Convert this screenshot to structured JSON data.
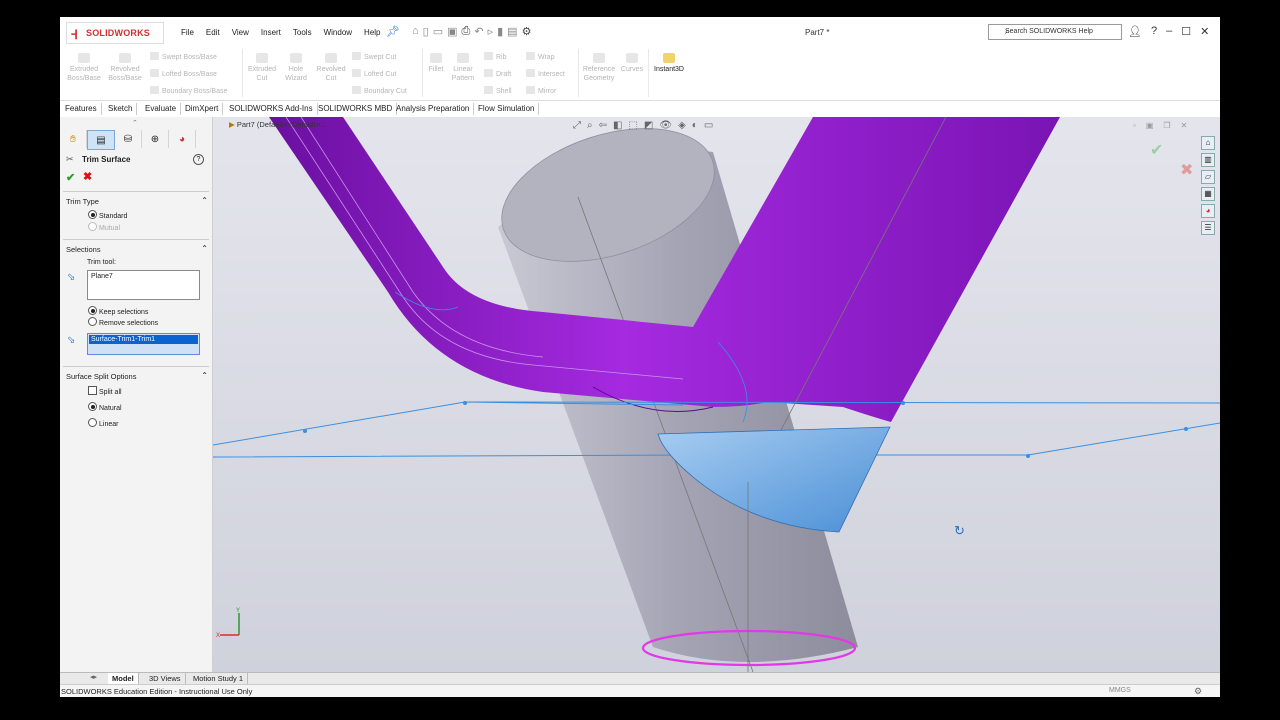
{
  "app": {
    "brand": "SOLIDWORKS",
    "document_title": "Part7 *",
    "help_search_placeholder": "Search SOLIDWORKS Help"
  },
  "menu": [
    "File",
    "Edit",
    "View",
    "Insert",
    "Tools",
    "Window",
    "Help"
  ],
  "ribbon": {
    "extruded_boss": "Extruded Boss/Base",
    "revolved_boss": "Revolved Boss/Base",
    "swept_boss": "Swept Boss/Base",
    "lofted_boss": "Lofted Boss/Base",
    "boundary_boss": "Boundary Boss/Base",
    "extruded_cut": "Extruded Cut",
    "hole_wizard": "Hole Wizard",
    "revolved_cut": "Revolved Cut",
    "swept_cut": "Swept Cut",
    "lofted_cut": "Lofted Cut",
    "boundary_cut": "Boundary Cut",
    "fillet": "Fillet",
    "linear_pattern": "Linear Pattern",
    "rib": "Rib",
    "draft": "Draft",
    "shell": "Shell",
    "wrap": "Wrap",
    "intersect": "Intersect",
    "mirror": "Mirror",
    "reference_geometry": "Reference Geometry",
    "curves": "Curves",
    "instant3d": "Instant3D"
  },
  "command_tabs": [
    "Features",
    "Sketch",
    "Evaluate",
    "DimXpert",
    "SOLIDWORKS Add-Ins",
    "SOLIDWORKS MBD",
    "Analysis Preparation",
    "Flow Simulation"
  ],
  "property_manager": {
    "title": "Trim Surface",
    "help_glyph": "?",
    "ok_glyph": "✔",
    "cancel_glyph": "✖",
    "trim_type": {
      "header": "Trim Type",
      "options": [
        "Standard",
        "Mutual"
      ],
      "selected": "Standard"
    },
    "selections": {
      "header": "Selections",
      "trim_tool_label": "Trim tool:",
      "trim_tool_value": "Plane7",
      "keep_label": "Keep selections",
      "remove_label": "Remove selections",
      "selected_surface": "Surface-Trim1-Trim1"
    },
    "split_options": {
      "header": "Surface Split Options",
      "split_all_label": "Split all",
      "natural_label": "Natural",
      "linear_label": "Linear"
    }
  },
  "viewport": {
    "tree_item": "Part7  (Default<<Default>..."
  },
  "bottom_tabs": [
    "Model",
    "3D Views",
    "Motion Study 1"
  ],
  "status": {
    "edition": "SOLIDWORKS Education Edition - Instructional Use Only",
    "units": "MMGS"
  },
  "colors": {
    "purple_surface": "#8a1fc7",
    "gray_cylinder": "#a9a9b8",
    "selection_blue": "#3b8fe0",
    "viewport_bg": "#d6d8e2"
  }
}
